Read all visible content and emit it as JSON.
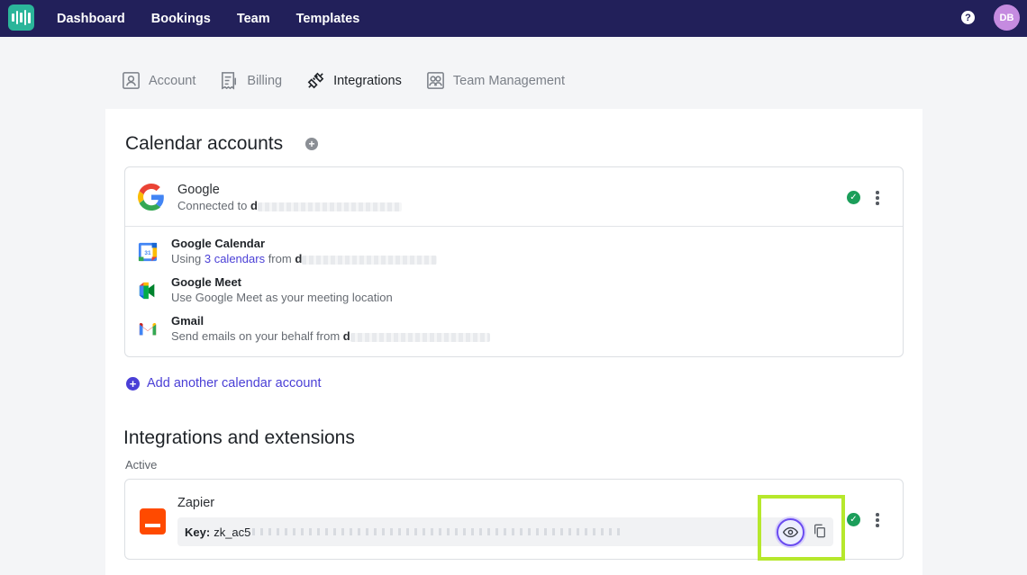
{
  "nav": {
    "links": [
      "Dashboard",
      "Bookings",
      "Team",
      "Templates"
    ],
    "help": "?",
    "avatar": "DB"
  },
  "tabs": {
    "account": "Account",
    "billing": "Billing",
    "integrations": "Integrations",
    "team": "Team Management",
    "active": "Integrations"
  },
  "calendar": {
    "title": "Calendar accounts",
    "account_name": "Google",
    "connected_prefix": "Connected to ",
    "connected_initial": "d",
    "services": [
      {
        "title": "Google Calendar",
        "desc_prefix": "Using ",
        "desc_link": "3 calendars",
        "desc_suffix": " from ",
        "desc_initial": "d"
      },
      {
        "title": "Google Meet",
        "desc": "Use Google Meet as your meeting location"
      },
      {
        "title": "Gmail",
        "desc_prefix": "Send emails on your behalf from ",
        "desc_initial": "d"
      }
    ],
    "add_account": "Add another calendar account"
  },
  "integrations": {
    "title": "Integrations and extensions",
    "active_label": "Active",
    "zapier": {
      "name": "Zapier",
      "key_label": "Key:",
      "key_value": "zk_ac5"
    }
  },
  "colors": {
    "nav_bg": "#22205a",
    "accent": "#4a3fd6",
    "success": "#1b9e5a",
    "highlight": "#b6e82c",
    "zapier": "#ff4a00"
  }
}
